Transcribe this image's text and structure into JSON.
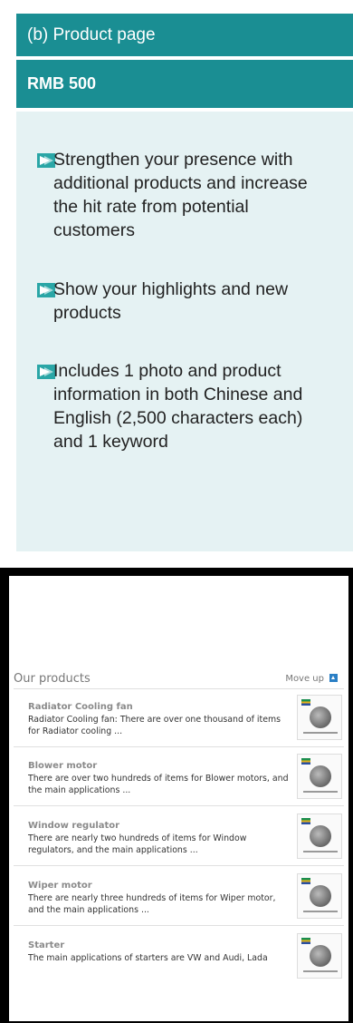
{
  "header": {
    "title": "(b) Product page",
    "price": "RMB 500"
  },
  "bullets": [
    "Strengthen your presence with additional products and increase the hit rate from potential customers",
    "Show your highlights and new products",
    "Includes 1 photo and product information in both Chinese and English (2,500 characters each) and 1 keyword"
  ],
  "screenshot": {
    "title": "Our products",
    "move_up": "Move up",
    "items": [
      {
        "name": "Radiator Cooling fan",
        "desc": "Radiator Cooling fan: There are over one thousand of items for Radiator cooling ..."
      },
      {
        "name": "Blower motor",
        "desc": "There are over two hundreds of items for Blower motors, and the main applications ..."
      },
      {
        "name": "Window regulator",
        "desc": "There are nearly two hundreds of items for Window regulators, and the main applications ..."
      },
      {
        "name": "Wiper motor",
        "desc": "There are nearly three hundreds of items for Wiper motor, and the main applications ..."
      },
      {
        "name": "Starter",
        "desc": "The main applications of starters are VW and Audi, Lada"
      }
    ]
  },
  "colors": {
    "accent": "#1a8e93",
    "panel": "#e5f2f3",
    "arrow": "#2aa6a6"
  }
}
